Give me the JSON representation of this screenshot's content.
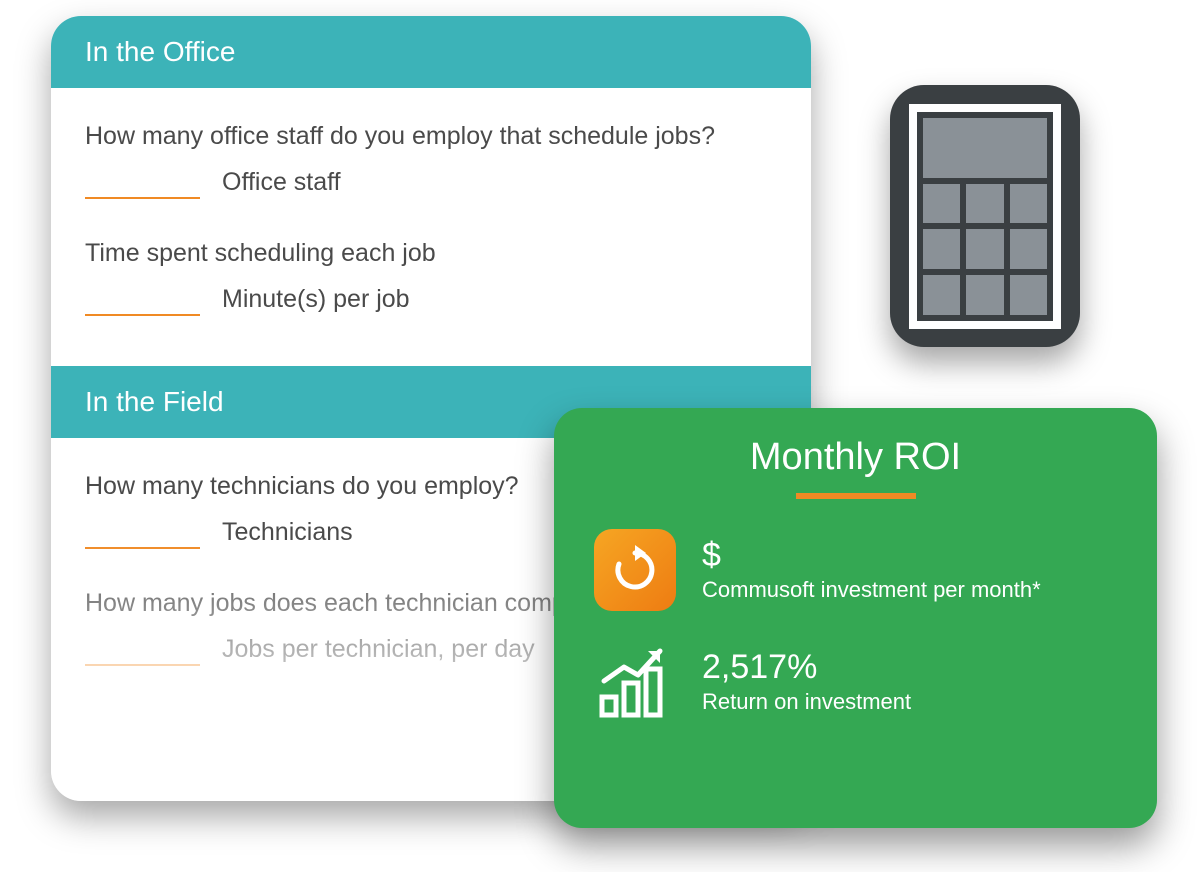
{
  "form": {
    "sections": [
      {
        "header": "In the Office",
        "questions": [
          {
            "prompt": "How many office staff do you employ that schedule jobs?",
            "unit": "Office staff"
          },
          {
            "prompt": "Time spent scheduling each job",
            "unit": "Minute(s) per job"
          }
        ]
      },
      {
        "header": "In the Field",
        "questions": [
          {
            "prompt": "How many technicians do you employ?",
            "unit": "Technicians"
          },
          {
            "prompt": "How many jobs does each technician complete per day?",
            "unit": "Jobs per technician, per day"
          }
        ]
      }
    ]
  },
  "roi": {
    "title": "Monthly ROI",
    "investment": {
      "value": "$",
      "label": "Commusoft investment per month*"
    },
    "return": {
      "value": "2,517%",
      "label": "Return on investment"
    }
  },
  "icons": {
    "calculator": "calculator-icon",
    "cycle": "cycle-icon",
    "growth": "growth-chart-icon"
  }
}
